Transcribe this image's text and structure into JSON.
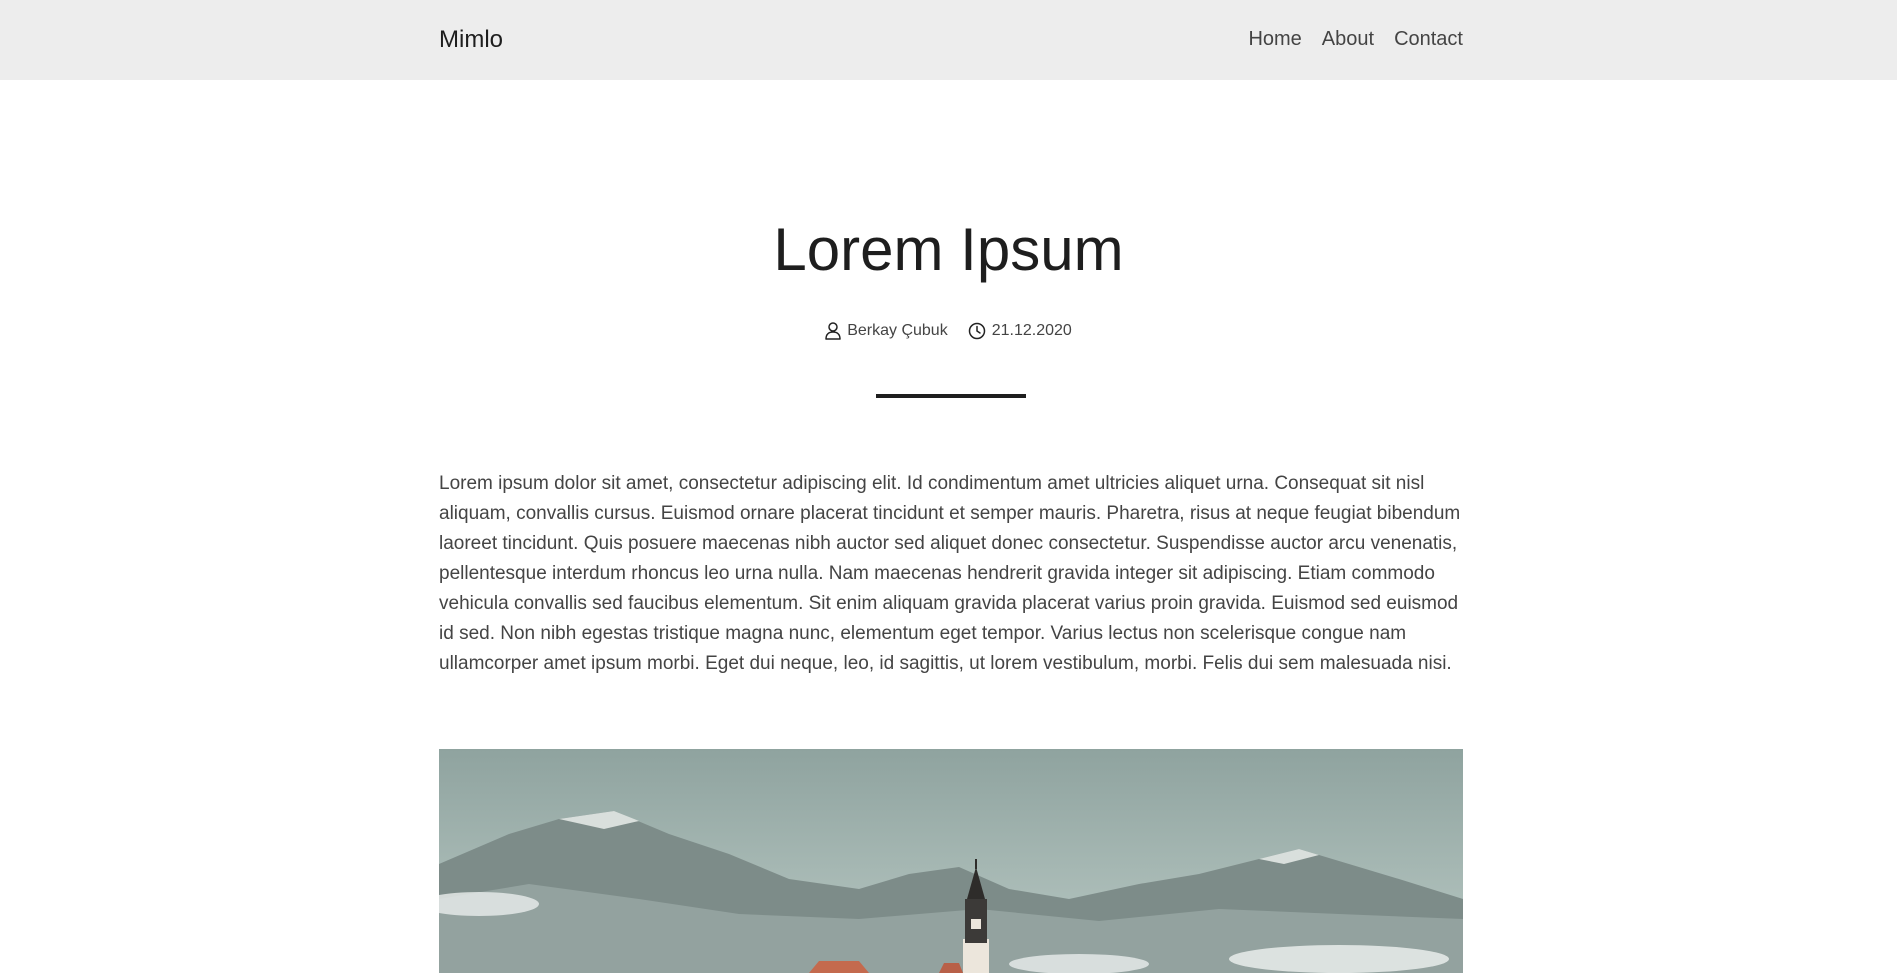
{
  "nav": {
    "brand": "Mimlo",
    "links": [
      "Home",
      "About",
      "Contact"
    ]
  },
  "post": {
    "title": "Lorem Ipsum",
    "author": "Berkay Çubuk",
    "date": "21.12.2020",
    "author_icon": "user-icon",
    "date_icon": "clock-icon",
    "body": "Lorem ipsum dolor sit amet, consectetur adipiscing elit. Id condimentum amet ultricies aliquet urna. Consequat sit nisl aliquam, convallis cursus. Euismod ornare placerat tincidunt et semper mauris. Pharetra, risus at neque feugiat bibendum laoreet tincidunt. Quis posuere maecenas nibh auctor sed aliquet donec consectetur. Suspendisse auctor arcu venenatis, pellentesque interdum rhoncus leo urna nulla. Nam maecenas hendrerit gravida integer sit adipiscing. Etiam commodo vehicula convallis sed faucibus elementum. Sit enim aliquam gravida placerat varius proin gravida. Euismod sed euismod id sed. Non nibh egestas tristique magna nunc, elementum eget tempor. Varius lectus non scelerisque congue nam ullamcorper amet ipsum morbi. Eget dui neque, leo, id sagittis, ut lorem vestibulum, morbi. Felis dui sem malesuada nisi."
  },
  "colors": {
    "navbar_bg": "#ededed",
    "text_dark": "#1e1e1e",
    "text_body": "#444444"
  }
}
